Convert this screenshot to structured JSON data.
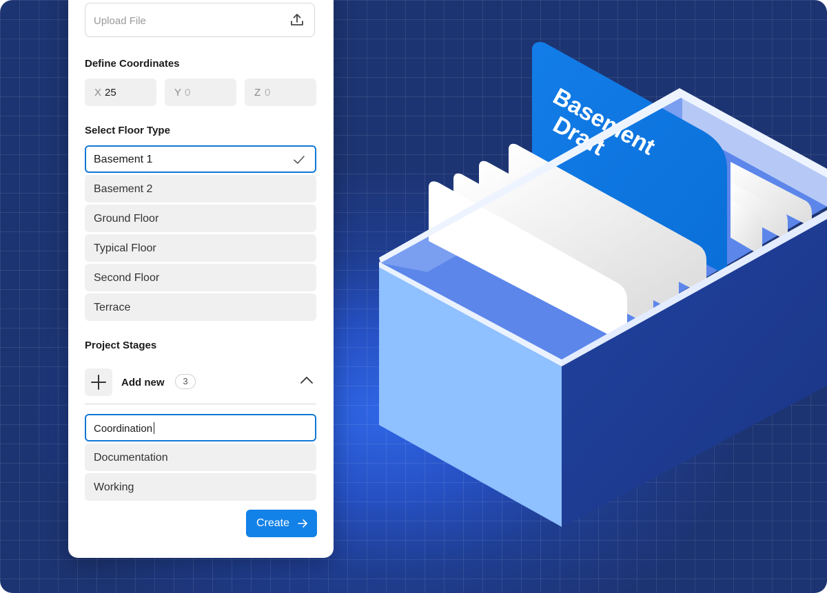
{
  "form": {
    "upload": {
      "placeholder": "Upload File",
      "icon": "upload-icon"
    },
    "coordinates": {
      "label": "Define Coordinates",
      "fields": [
        {
          "axis": "X",
          "value": "25"
        },
        {
          "axis": "Y",
          "value": "0"
        },
        {
          "axis": "Z",
          "value": "0"
        }
      ]
    },
    "floor_type": {
      "label": "Select Floor Type",
      "options": [
        "Basement 1",
        "Basement 2",
        "Ground Floor",
        "Typical Floor",
        "Second Floor",
        "Terrace"
      ],
      "selected": "Basement 1"
    },
    "project_stages": {
      "label": "Project Stages",
      "add_new_label": "Add new",
      "count": "3",
      "input_value": "Coordination",
      "items": [
        "Documentation",
        "Working"
      ]
    },
    "create_label": "Create"
  },
  "illustration": {
    "tab_label_line1": "Basement",
    "tab_label_line2": "Draft"
  },
  "colors": {
    "accent": "#1281e8",
    "background": "#1f3d8f",
    "tab": "#0a78e6"
  }
}
